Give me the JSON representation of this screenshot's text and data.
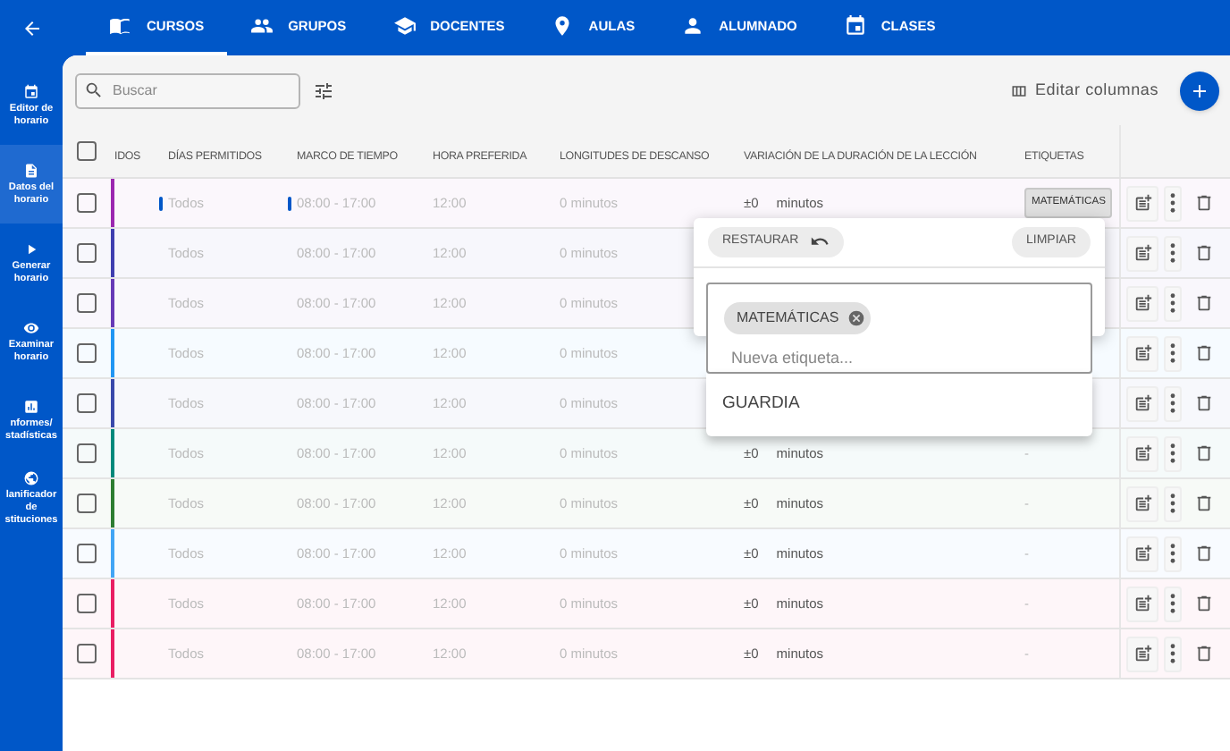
{
  "top_bar": {
    "tabs": [
      {
        "label": "CURSOS",
        "selected": true
      },
      {
        "label": "GRUPOS",
        "selected": false
      },
      {
        "label": "DOCENTES",
        "selected": false
      },
      {
        "label": "AULAS",
        "selected": false
      },
      {
        "label": "ALUMNADO",
        "selected": false
      },
      {
        "label": "CLASES",
        "selected": false
      }
    ]
  },
  "sidebar": {
    "items": [
      {
        "label": "Editor de horario",
        "selected": false
      },
      {
        "label": "Datos del horario",
        "selected": true
      },
      {
        "label": "Generar horario",
        "selected": false
      },
      {
        "label": "Examinar horario",
        "selected": false
      },
      {
        "label": "nformes/ stadísticas",
        "selected": false
      },
      {
        "label": "lanificador de stituciones",
        "selected": false
      }
    ]
  },
  "toolbar": {
    "search_placeholder": "Buscar",
    "edit_columns": "Editar columnas"
  },
  "table": {
    "all_checked": false,
    "columns": [
      "IDOS",
      "DÍAS PERMITIDOS",
      "MARCO DE TIEMPO",
      "HORA PREFERIDA",
      "LONGITUDES DE DESCANSO",
      "VARIACIÓN DE LA DURACIÓN DE LA LECCIÓN",
      "ETIQUETAS"
    ],
    "rows": [
      {
        "color": "#9c27b0",
        "flagged": true,
        "checked": false,
        "days": "Todos",
        "time_frame": "08:00 - 17:00",
        "preferred": "12:00",
        "breaks": "0 minutos",
        "variation": "±0",
        "variation_unit": "minutos",
        "tag": "MATEMÁTICAS"
      },
      {
        "color": "#3f3fb0",
        "flagged": false,
        "checked": false,
        "days": "Todos",
        "time_frame": "08:00 - 17:00",
        "preferred": "12:00",
        "breaks": "0 minutos"
      },
      {
        "color": "#673ab7",
        "flagged": false,
        "checked": false,
        "days": "Todos",
        "time_frame": "08:00 - 17:00",
        "preferred": "12:00",
        "breaks": "0 minutos"
      },
      {
        "color": "#2196f3",
        "flagged": false,
        "checked": false,
        "days": "Todos",
        "time_frame": "08:00 - 17:00",
        "preferred": "12:00",
        "breaks": "0 minutos"
      },
      {
        "color": "#3949ab",
        "flagged": false,
        "checked": false,
        "days": "Todos",
        "time_frame": "08:00 - 17:00",
        "preferred": "12:00",
        "breaks": "0 minutos"
      },
      {
        "color": "#00897b",
        "flagged": false,
        "checked": false,
        "days": "Todos",
        "time_frame": "08:00 - 17:00",
        "preferred": "12:00",
        "breaks": "0 minutos",
        "variation": "±0",
        "variation_unit": "minutos",
        "tag": "-"
      },
      {
        "color": "#2e7d32",
        "flagged": false,
        "checked": false,
        "days": "Todos",
        "time_frame": "08:00 - 17:00",
        "preferred": "12:00",
        "breaks": "0 minutos",
        "variation": "±0",
        "variation_unit": "minutos",
        "tag": "-"
      },
      {
        "color": "#42a5f5",
        "flagged": false,
        "checked": false,
        "days": "Todos",
        "time_frame": "08:00 - 17:00",
        "preferred": "12:00",
        "breaks": "0 minutos",
        "variation": "±0",
        "variation_unit": "minutos",
        "tag": "-"
      },
      {
        "color": "#e91e63",
        "flagged": false,
        "checked": false,
        "days": "Todos",
        "time_frame": "08:00 - 17:00",
        "preferred": "12:00",
        "breaks": "0 minutos",
        "variation": "±0",
        "variation_unit": "minutos",
        "tag": "-"
      },
      {
        "color": "#e91e63",
        "flagged": false,
        "checked": false,
        "days": "Todos",
        "time_frame": "08:00 - 17:00",
        "preferred": "12:00",
        "breaks": "0 minutos",
        "variation": "±0",
        "variation_unit": "minutos",
        "tag": "-"
      }
    ]
  },
  "tag_popup": {
    "restore": "RESTAURAR",
    "clear": "LIMPIAR",
    "tags": [
      "MATEMÁTICAS"
    ],
    "placeholder": "Nueva etiqueta...",
    "options": [
      "GUARDIA"
    ]
  }
}
